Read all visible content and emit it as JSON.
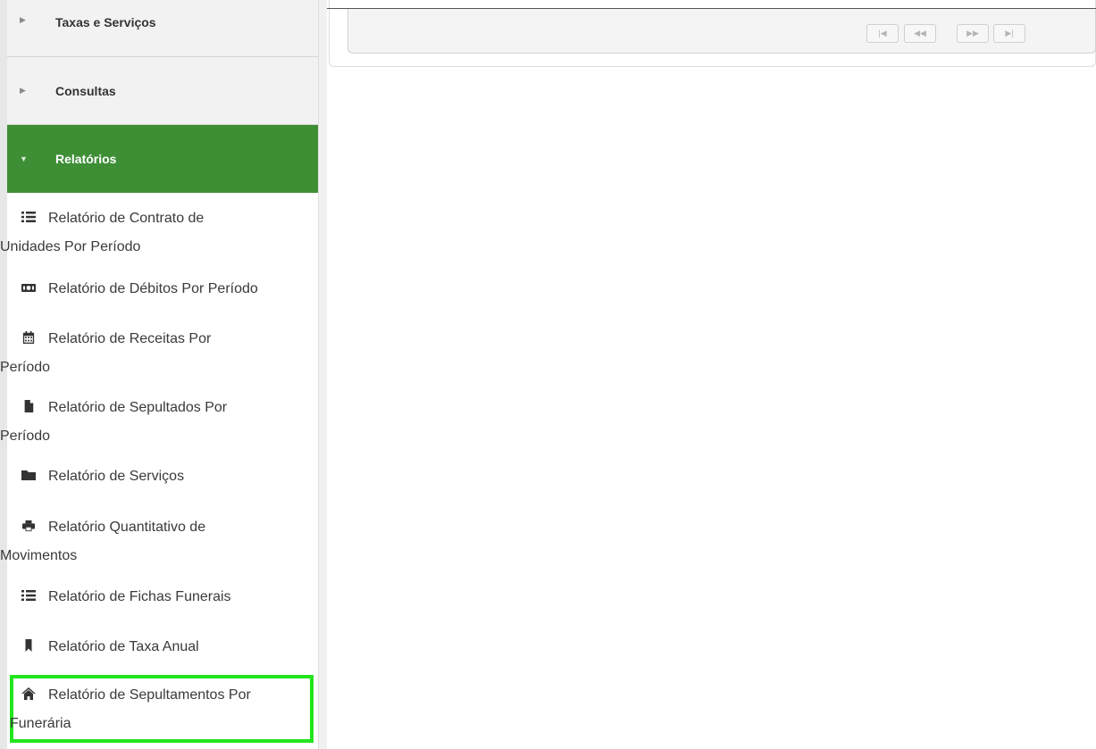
{
  "sidebar": {
    "headers": {
      "taxas": {
        "label": "Taxas e Serviços",
        "caret": "▶",
        "icon": "caret-right-icon"
      },
      "consultas": {
        "label": "Consultas",
        "caret": "▶",
        "icon": "caret-right-icon"
      },
      "relatorios": {
        "label": "Relatórios",
        "caret": "▼",
        "icon": "caret-down-icon",
        "active_color": "#3e8e36"
      }
    },
    "reports": [
      {
        "line1": "Relatório de Contrato de",
        "line2": "Unidades Por Período",
        "icon": "list-icon"
      },
      {
        "line1": "Relatório de Débitos Por Período",
        "line2": "",
        "icon": "money-bill-icon"
      },
      {
        "line1": "Relatório de Receitas Por",
        "line2": "Período",
        "icon": "calendar-icon"
      },
      {
        "line1": "Relatório de Sepultados Por",
        "line2": "Período",
        "icon": "file-icon"
      },
      {
        "line1": "Relatório de Serviços",
        "line2": "",
        "icon": "folder-icon"
      },
      {
        "line1": "Relatório Quantitativo de",
        "line2": "Movimentos",
        "icon": "print-icon"
      },
      {
        "line1": "Relatório de Fichas Funerais",
        "line2": "",
        "icon": "list-icon"
      },
      {
        "line1": "Relatório de Taxa Anual",
        "line2": "",
        "icon": "bookmark-icon"
      },
      {
        "line1": "Relatório de Sepultamentos Por",
        "line2": "Funerária",
        "icon": "home-icon",
        "highlight_color": "#22e51d"
      }
    ]
  },
  "pager": {
    "first": "|◀",
    "prev": "◀◀",
    "next": "▶▶",
    "last": "▶|"
  }
}
